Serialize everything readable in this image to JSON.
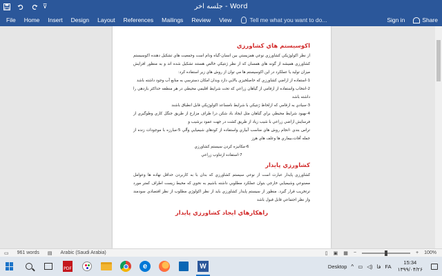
{
  "window": {
    "title": "جلسه اخر - Word",
    "colors": {
      "ribbon": "#2b579a",
      "heading": "#d22d2d"
    }
  },
  "quick_access": {
    "save_icon": "save-icon",
    "undo_icon": "undo-icon",
    "redo_icon": "redo-icon"
  },
  "ribbon": {
    "tabs": [
      "File",
      "Home",
      "Insert",
      "Design",
      "Layout",
      "References",
      "Mailings",
      "Review",
      "View"
    ],
    "tell_me": "Tell me what you want to do...",
    "sign_in": "Sign in",
    "share": "Share"
  },
  "document": {
    "heading1": "اکوسیستم هاي کشاورزي",
    "para1": "از نظر اکولوژيکي کشاورزي نوعي همزيستي بين انسان-گياه ودام است وجمعيت هاي تشکيل دهنده اکوسيستم کشاورزي هميشه از گونه هاي همسان که از نظر ژنتيکي خالص هستند تشکيل شده اند و به منظور افزايش ميزان توليد يا عملکرد در اين اکوسيستم ها مي توان از روش هاي زير استفاده کرد:",
    "items": [
      "1-استفاده از اراضي کشاورزي که حاصلخيزي بالايي دارد وبدان امکان دسترسي به منابع آب وجود داشته باشد",
      "2-انتخاب واستفاده از ارقامي از گياهان زراعي که تحت شرايط اقليمي محيطي در هر منطقه حداکثر بازدهي را داشته باشد",
      "3-سيادي به ارقامي که ازلحاظ ژنتيکي با شرايط نامساعد اکولوژيکي قابل انطباق باشند",
      "4-بهبود شرايط محيطي براي گياهان مثل ايجاد باد شکن درا طراف مزارع از طريق جنگل کاري وطوگيري از فرسايش اراضي زراعي با شيب زياد از طريق کشت در جهت عمود برشيب و",
      "تراس بندي -انجام روش هاي مناسب آبياري واستفاده از کودهاي شيميايي وآلي 5-مبارزه با موجودات زنده از جمله آفات،بيماري ها وعلف هاي هرز",
      "6-مکانيزه کردن سيستم کشاورزي",
      "7-استفاده ازتناوب زراعي"
    ],
    "heading2": "کشاورزي پايدار",
    "para2": "کشاورزي پايدار عبارت است از نوعي سيستم کشاورزي که بدان با به کاربردن حداقل نهاده ها وعوامل مصنوعي وشيميايي خارجي بتوان عملکرد مطلوبي داشته باشيم به نحوي که محيط زيست اطراف کمتر مورد ترتخريب قرار گيرد. منظور از سيستم پايدار کشاورزي بايد از نظر اکولوژي مطلوب از نظر اقتصادي سودمند واز نظر اجتماعي قابل قبول باشد",
    "heading3": "راهکارهاي ايجاد کشاورزي پايدار"
  },
  "status": {
    "words": "961 words",
    "language": "Arabic (Saudi Arabia)",
    "zoom": "100%"
  },
  "taskbar": {
    "desktop": "Desktop",
    "lang": "FA",
    "time": "15:34",
    "date": "۱۳۹۹/۰۴/۲۶",
    "tray_text": "فا"
  }
}
